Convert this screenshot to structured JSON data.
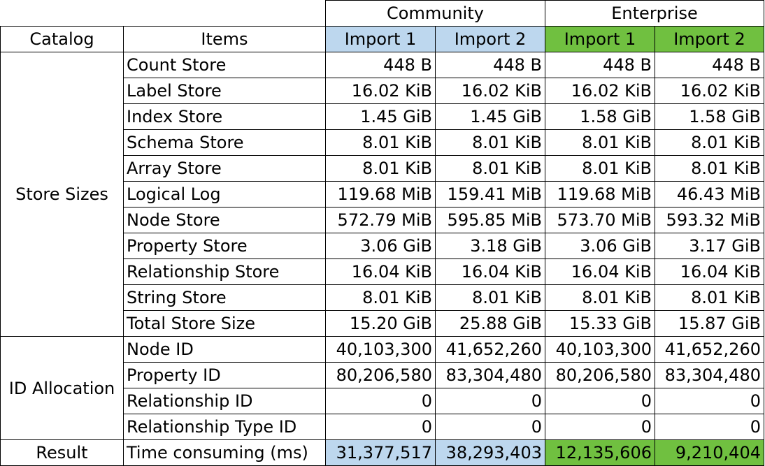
{
  "editions": [
    "Community",
    "Enterprise"
  ],
  "header": {
    "catalog": "Catalog",
    "items": "Items",
    "imports": [
      "Import 1",
      "Import 2",
      "Import 1",
      "Import 2"
    ]
  },
  "colors": {
    "community_header": "#bdd7ee",
    "enterprise_header": "#70c040"
  },
  "sections": [
    {
      "catalog": "Store Sizes",
      "rows": [
        {
          "item": "Count Store",
          "values": [
            "448 B",
            "448 B",
            "448 B",
            "448 B"
          ]
        },
        {
          "item": "Label Store",
          "values": [
            "16.02 KiB",
            "16.02 KiB",
            "16.02 KiB",
            "16.02 KiB"
          ]
        },
        {
          "item": "Index Store",
          "values": [
            "1.45 GiB",
            "1.45 GiB",
            "1.58 GiB",
            "1.58 GiB"
          ]
        },
        {
          "item": "Schema Store",
          "values": [
            "8.01 KiB",
            "8.01 KiB",
            "8.01 KiB",
            "8.01 KiB"
          ]
        },
        {
          "item": "Array Store",
          "values": [
            "8.01 KiB",
            "8.01 KiB",
            "8.01 KiB",
            "8.01 KiB"
          ]
        },
        {
          "item": "Logical Log",
          "values": [
            "119.68 MiB",
            "159.41 MiB",
            "119.68 MiB",
            "46.43 MiB"
          ]
        },
        {
          "item": "Node Store",
          "values": [
            "572.79 MiB",
            "595.85 MiB",
            "573.70 MiB",
            "593.32 MiB"
          ]
        },
        {
          "item": "Property Store",
          "values": [
            "3.06 GiB",
            "3.18 GiB",
            "3.06 GiB",
            "3.17 GiB"
          ]
        },
        {
          "item": "Relationship Store",
          "values": [
            "16.04 KiB",
            "16.04 KiB",
            "16.04 KiB",
            "16.04 KiB"
          ]
        },
        {
          "item": "String Store",
          "values": [
            "8.01 KiB",
            "8.01 KiB",
            "8.01 KiB",
            "8.01 KiB"
          ]
        },
        {
          "item": "Total Store Size",
          "values": [
            "15.20 GiB",
            "25.88 GiB",
            "15.33 GiB",
            "15.87 GiB"
          ]
        }
      ]
    },
    {
      "catalog": "ID Allocation",
      "rows": [
        {
          "item": "Node ID",
          "values": [
            "40,103,300",
            "41,652,260",
            "40,103,300",
            "41,652,260"
          ]
        },
        {
          "item": "Property ID",
          "values": [
            "80,206,580",
            "83,304,480",
            "80,206,580",
            "83,304,480"
          ]
        },
        {
          "item": "Relationship ID",
          "values": [
            "0",
            "0",
            "0",
            "0"
          ]
        },
        {
          "item": "Relationship Type ID",
          "values": [
            "0",
            "0",
            "0",
            "0"
          ]
        }
      ]
    },
    {
      "catalog": "Result",
      "rows": [
        {
          "item": "Time consuming (ms)",
          "values": [
            "31,377,517",
            "38,293,403",
            "12,135,606",
            "9,210,404"
          ]
        }
      ]
    }
  ]
}
